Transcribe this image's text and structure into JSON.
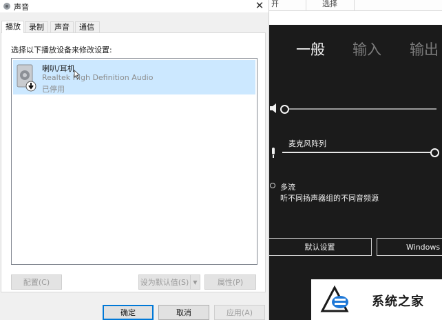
{
  "bg_app": {
    "top_cells": [
      "开",
      "选择"
    ],
    "nav_tabs": [
      "一般",
      "输入",
      "输出"
    ],
    "mic_label": "麦克风阵列",
    "multistream_label": "多流",
    "multistream_desc": "听不同扬声器组的不同音频源",
    "default_settings_button": "默认设置",
    "windows_button": "Windows 声"
  },
  "watermark": {
    "text": "系统之家"
  },
  "dialog": {
    "title": "声音",
    "close_glyph": "✕",
    "tabs": [
      "播放",
      "录制",
      "声音",
      "通信"
    ],
    "panel_label": "选择以下播放设备来修改设置:",
    "device": {
      "name": "喇叭/耳机",
      "driver": "Realtek High Definition Audio",
      "status": "已停用"
    },
    "configure_button": "配置(C)",
    "set_default_button": "设为默认值(S)",
    "properties_button": "属性(P)",
    "ok_button": "确定",
    "cancel_button": "取消",
    "apply_button": "应用(A)"
  }
}
